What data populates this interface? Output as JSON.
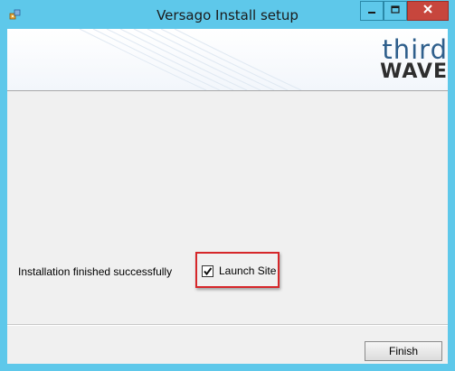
{
  "window": {
    "title": "Versago Install setup",
    "app_icon": "installer-icon",
    "controls": [
      "minimize-icon",
      "maximize-icon",
      "close-icon"
    ]
  },
  "banner": {
    "logo_line1": "third",
    "logo_line2": "WAVE"
  },
  "main": {
    "status_text": "Installation finished successfully",
    "launch_site": {
      "label": "Launch Site",
      "checked": true
    }
  },
  "footer": {
    "finish_label": "Finish"
  },
  "colors": {
    "titlebar": "#5ec8ea",
    "close_button": "#c7463d",
    "highlight": "#d6272a",
    "logo_blue": "#2f5f8c"
  }
}
